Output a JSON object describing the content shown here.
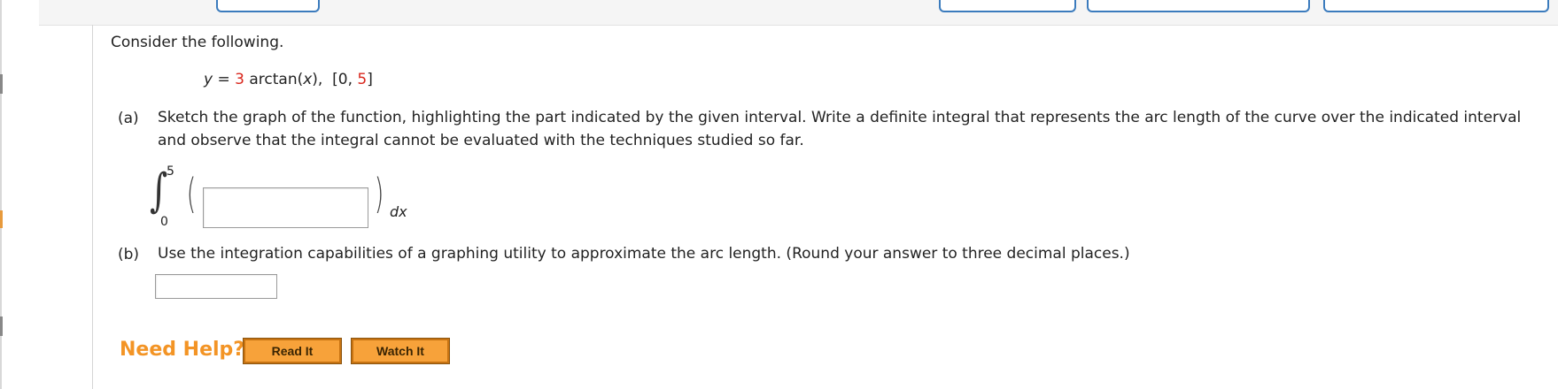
{
  "question": {
    "intro": "Consider the following.",
    "equation": {
      "lhs": "y",
      "equals": " = ",
      "coef": "3",
      "func_prefix": " arctan(",
      "var": "x",
      "func_suffix": "),",
      "interval_open": "[0, ",
      "interval_end": "5",
      "interval_close": "]"
    }
  },
  "part_a": {
    "label": "(a)",
    "text": "Sketch the graph of the function, highlighting the part indicated by the given interval. Write a definite integral that represents the arc length of the curve over the indicated interval and observe that the integral cannot be evaluated with the techniques studied so far.",
    "upper_limit": "5",
    "lower_limit": "0",
    "differential": "dx",
    "integrand_value": ""
  },
  "part_b": {
    "label": "(b)",
    "text": "Use the integration capabilities of a graphing utility to approximate the arc length. (Round your answer to three decimal places.)",
    "answer_value": ""
  },
  "help": {
    "title": "Need Help?",
    "read_it": "Read It",
    "watch_it": "Watch It"
  },
  "colors": {
    "red_number": "#d9261c",
    "need_help": "#f39425",
    "button_fill": "#f7a23a",
    "tab_border": "#3b7bbd"
  }
}
